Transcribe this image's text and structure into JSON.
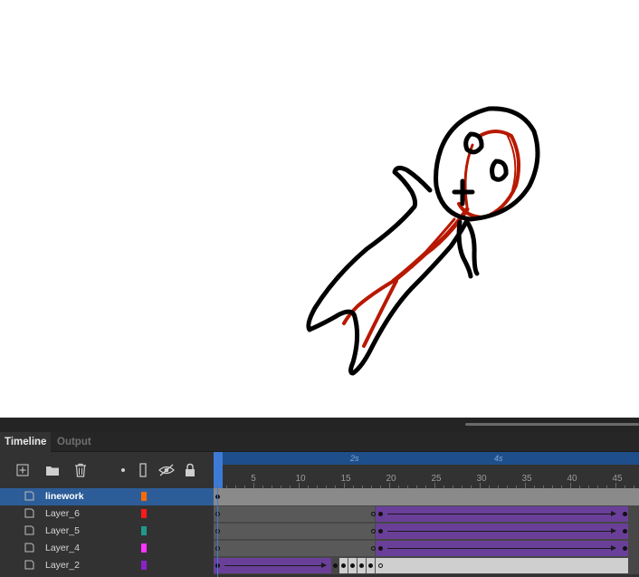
{
  "timeline": {
    "tabs": [
      {
        "label": "Timeline",
        "active": true
      },
      {
        "label": "Output",
        "active": false
      }
    ],
    "toolbar_icons": [
      "new-layer-icon",
      "folder-icon",
      "trash-icon",
      "show-as-dot-icon",
      "outline-icon",
      "visibility-icon",
      "lock-icon"
    ],
    "ruler": {
      "seconds": [
        "2s",
        "4s"
      ],
      "frame_numbers": [
        "5",
        "10",
        "15",
        "20",
        "25",
        "30",
        "35",
        "40",
        "45"
      ]
    },
    "layers": [
      {
        "name": "linework",
        "color": "#ff6a00",
        "selected": true
      },
      {
        "name": "Layer_6",
        "color": "#ff1a1a",
        "selected": false
      },
      {
        "name": "Layer_5",
        "color": "#1f9a8a",
        "selected": false
      },
      {
        "name": "Layer_4",
        "color": "#ff33ff",
        "selected": false
      },
      {
        "name": "Layer_2",
        "color": "#8a22cc",
        "selected": false
      }
    ]
  },
  "colors": {
    "accent": "#3d7ad6",
    "tween": "#6a3f99",
    "drawing_stroke": "#000000",
    "drawing_red": "#b81800"
  }
}
